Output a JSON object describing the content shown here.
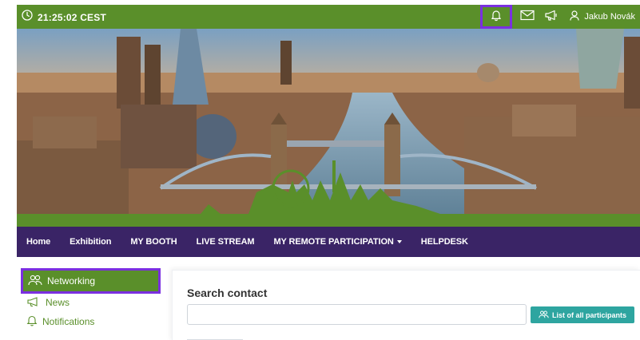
{
  "topbar": {
    "time": "21:25:02",
    "timezone": "CEST",
    "user_name": "Jakub Novák"
  },
  "nav": {
    "items": [
      {
        "label": "Home"
      },
      {
        "label": "Exhibition"
      },
      {
        "label": "MY BOOTH"
      },
      {
        "label": "LIVE STREAM"
      },
      {
        "label": "MY REMOTE PARTICIPATION",
        "has_dropdown": true
      },
      {
        "label": "HELPDESK"
      }
    ]
  },
  "sidebar": {
    "items": [
      {
        "label": "Networking",
        "icon": "users-icon",
        "active": true
      },
      {
        "label": "News",
        "icon": "megaphone-icon"
      },
      {
        "label": "Notifications",
        "icon": "bell-icon"
      }
    ]
  },
  "search_contact": {
    "title": "Search contact",
    "input_value": "",
    "list_button_label": "List of all participants"
  },
  "colors": {
    "green": "#5a8f2a",
    "purple_nav": "#3a2466",
    "highlight": "#7b2fe0",
    "teal": "#2ea5a0"
  }
}
